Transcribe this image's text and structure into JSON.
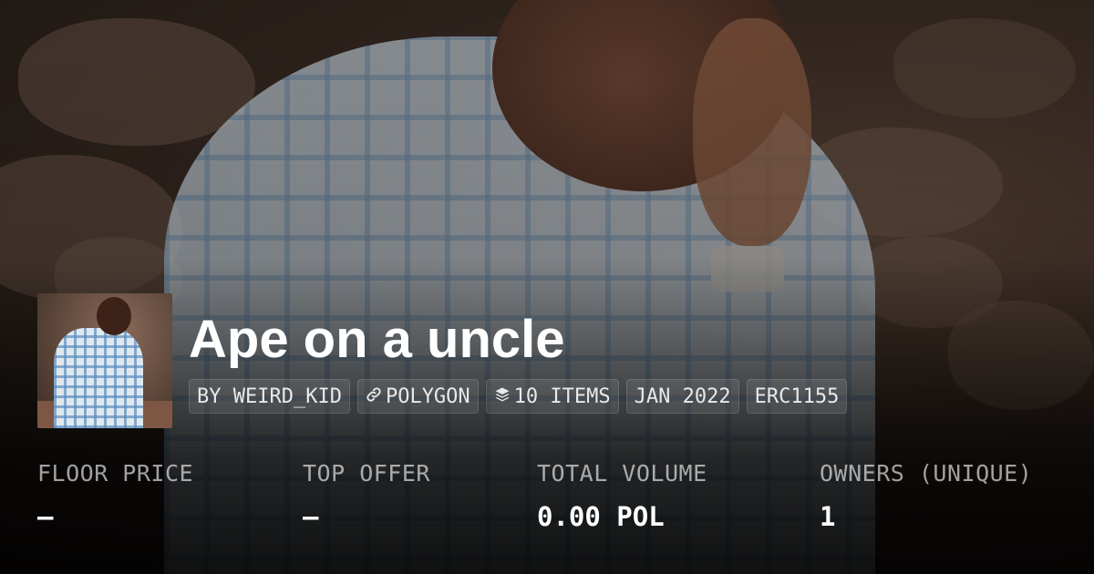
{
  "collection": {
    "title": "Ape on a uncle",
    "tags": [
      {
        "label": "BY WEIRD_KID",
        "icon": ""
      },
      {
        "label": "POLYGON",
        "icon": "link-icon"
      },
      {
        "label": "10 ITEMS",
        "icon": "layers-icon"
      },
      {
        "label": "JAN 2022",
        "icon": ""
      },
      {
        "label": "ERC1155",
        "icon": ""
      }
    ]
  },
  "stats": [
    {
      "label": "FLOOR PRICE",
      "value": "–"
    },
    {
      "label": "TOP OFFER",
      "value": "–"
    },
    {
      "label": "TOTAL VOLUME",
      "value": "0.00 POL"
    },
    {
      "label": "OWNERS (UNIQUE)",
      "value": "1"
    }
  ],
  "colors": {
    "text_primary": "#ffffff",
    "text_muted": "#9e9e9e",
    "tag_bg": "#3a3330"
  }
}
